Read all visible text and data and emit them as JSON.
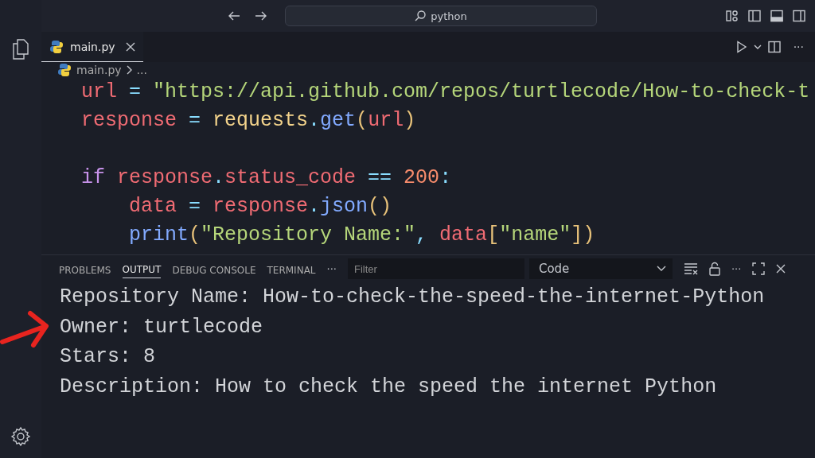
{
  "title_bar": {
    "search": "python"
  },
  "tabs": [
    {
      "label": "main.py",
      "selected": true
    }
  ],
  "breadcrumb": [
    "main.py",
    "..."
  ],
  "editor": {
    "lines": [
      {
        "tokens": [
          {
            "text": "url",
            "kind": "var"
          },
          {
            "text": " = ",
            "kind": "op"
          },
          {
            "text": "\"https://api.github.com/repos/turtlecode/How-to-check-t",
            "kind": "str"
          }
        ]
      },
      {
        "tokens": [
          {
            "text": "response",
            "kind": "var"
          },
          {
            "text": " = ",
            "kind": "op"
          },
          {
            "text": "requests",
            "kind": "cls"
          },
          {
            "text": ".",
            "kind": "op"
          },
          {
            "text": "get",
            "kind": "fn"
          },
          {
            "text": "(",
            "kind": "paren"
          },
          {
            "text": "url",
            "kind": "var"
          },
          {
            "text": ")",
            "kind": "paren"
          }
        ]
      },
      {
        "kind": "blank"
      },
      {
        "tokens": [
          {
            "text": "if ",
            "kind": "kw"
          },
          {
            "text": "response",
            "kind": "var"
          },
          {
            "text": ".",
            "kind": "op"
          },
          {
            "text": "status_code",
            "kind": "var"
          },
          {
            "text": " == ",
            "kind": "op"
          },
          {
            "text": "200",
            "kind": "num"
          },
          {
            "text": ":",
            "kind": "op"
          }
        ]
      },
      {
        "tokens": [
          {
            "text": "    data",
            "kind": "var"
          },
          {
            "text": " = ",
            "kind": "op"
          },
          {
            "text": "response",
            "kind": "var"
          },
          {
            "text": ".",
            "kind": "op"
          },
          {
            "text": "json",
            "kind": "fn"
          },
          {
            "text": "()",
            "kind": "paren"
          }
        ]
      },
      {
        "tokens": [
          {
            "text": "    print",
            "kind": "fn"
          },
          {
            "text": "(",
            "kind": "paren"
          },
          {
            "text": "\"Repository Name:\"",
            "kind": "str"
          },
          {
            "text": ", ",
            "kind": "op"
          },
          {
            "text": "data",
            "kind": "var"
          },
          {
            "text": "[",
            "kind": "paren"
          },
          {
            "text": "\"name\"",
            "kind": "str"
          },
          {
            "text": "])",
            "kind": "paren"
          }
        ]
      }
    ]
  },
  "panel": {
    "tabs": [
      {
        "label": "PROBLEMS",
        "selected": false
      },
      {
        "label": "OUTPUT",
        "selected": true
      },
      {
        "label": "DEBUG CONSOLE",
        "selected": false
      },
      {
        "label": "TERMINAL",
        "selected": false
      }
    ],
    "more": "···",
    "filter_placeholder": "Filter",
    "channel": "Code",
    "output": [
      "Repository Name: How-to-check-the-speed-the-internet-Python",
      "Owner: turtlecode",
      "Stars: 8",
      "Description: How to check the speed the internet Python"
    ]
  }
}
